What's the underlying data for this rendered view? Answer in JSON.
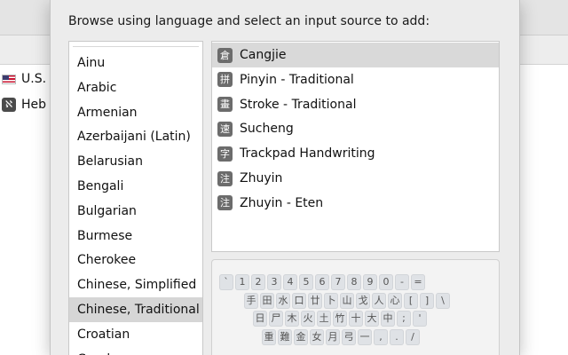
{
  "background_window": {
    "rows": [
      {
        "label": "U.S.",
        "icon": "us-flag-icon"
      },
      {
        "label": "Heb",
        "icon": "hebrew-input-icon",
        "glyph": "ℵ"
      }
    ]
  },
  "sheet": {
    "prompt": "Browse using language and select an input source to add:",
    "languages": [
      "Ainu",
      "Arabic",
      "Armenian",
      "Azerbaijani (Latin)",
      "Belarusian",
      "Bengali",
      "Bulgarian",
      "Burmese",
      "Cherokee",
      "Chinese, Simplified",
      "Chinese, Traditional",
      "Croatian",
      "Czech"
    ],
    "selected_language": "Chinese, Traditional",
    "input_sources": [
      {
        "label": "Cangjie",
        "glyph": "倉",
        "icon": "cangjie-icon"
      },
      {
        "label": "Pinyin - Traditional",
        "glyph": "拼",
        "icon": "pinyin-icon"
      },
      {
        "label": "Stroke - Traditional",
        "glyph": "畫",
        "icon": "stroke-icon"
      },
      {
        "label": "Sucheng",
        "glyph": "速",
        "icon": "sucheng-icon"
      },
      {
        "label": "Trackpad Handwriting",
        "glyph": "字",
        "icon": "handwriting-icon"
      },
      {
        "label": "Zhuyin",
        "glyph": "注",
        "icon": "zhuyin-icon"
      },
      {
        "label": "Zhuyin - Eten",
        "glyph": "注",
        "icon": "zhuyin-eten-icon"
      }
    ],
    "selected_source": "Cangjie",
    "keyboard_preview": {
      "rows": [
        [
          "`",
          "1",
          "2",
          "3",
          "4",
          "5",
          "6",
          "7",
          "8",
          "9",
          "0",
          "-",
          "="
        ],
        [
          "手",
          "田",
          "水",
          "口",
          "廿",
          "卜",
          "山",
          "戈",
          "人",
          "心",
          "[",
          "]",
          "\\"
        ],
        [
          "日",
          "尸",
          "木",
          "火",
          "土",
          "竹",
          "十",
          "大",
          "中",
          ";",
          "'"
        ],
        [
          "重",
          "難",
          "金",
          "女",
          "月",
          "弓",
          "一",
          ",",
          ".",
          "/"
        ]
      ]
    }
  }
}
